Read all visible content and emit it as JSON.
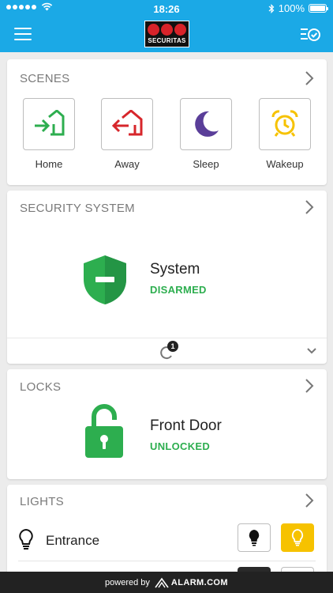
{
  "status_bar": {
    "time": "18:26",
    "battery": "100%"
  },
  "header": {
    "logo_text": "SECURITAS"
  },
  "scenes": {
    "title": "SCENES",
    "items": [
      {
        "label": "Home",
        "icon": "home-arrive-icon",
        "color": "#2dae4f"
      },
      {
        "label": "Away",
        "icon": "home-leave-icon",
        "color": "#d7262b"
      },
      {
        "label": "Sleep",
        "icon": "moon-icon",
        "color": "#5a3e99"
      },
      {
        "label": "Wakeup",
        "icon": "alarm-clock-icon",
        "color": "#f6c200"
      }
    ]
  },
  "security": {
    "title": "SECURITY SYSTEM",
    "device_name": "System",
    "state": "DISARMED",
    "state_color": "#2dae4f",
    "pending_count": "1"
  },
  "locks": {
    "title": "LOCKS",
    "device_name": "Front Door",
    "state": "UNLOCKED",
    "state_color": "#2dae4f"
  },
  "lights": {
    "title": "LIGHTS",
    "items": [
      {
        "name": "Entrance",
        "state": "on"
      }
    ]
  },
  "footer": {
    "powered_by": "powered by",
    "brand": "ALARM.COM"
  },
  "colors": {
    "accent": "#1ba9e6",
    "light_on": "#f6c200"
  }
}
